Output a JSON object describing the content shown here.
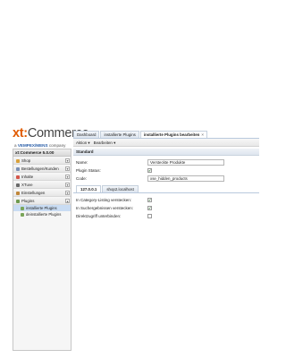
{
  "logo": {
    "brand_xt": "xt",
    "brand_colon": ":",
    "brand_name": "Commerce",
    "sub_prefix": "a",
    "sub_brand": "VEMPEX/MENS",
    "sub_suffix": "company"
  },
  "sidebar": {
    "title": "xt:Commerce 5.0.00",
    "items": [
      {
        "label": "Shop",
        "icon": "shop-icon",
        "color": "#d9a13a"
      },
      {
        "label": "Bestellungen/Kunden",
        "icon": "orders-icon",
        "color": "#7a8fb4"
      },
      {
        "label": "Inhalte",
        "icon": "content-icon",
        "color": "#d4564a"
      },
      {
        "label": "XTuve",
        "icon": "video-icon",
        "color": "#6a6a6a"
      },
      {
        "label": "Einstellungen",
        "icon": "settings-icon",
        "color": "#c0873a"
      },
      {
        "label": "Plugins",
        "icon": "plugin-icon",
        "color": "#6e9b4f"
      }
    ],
    "subitems": [
      {
        "label": "installierte Plugins",
        "selected": true
      },
      {
        "label": "deinstallierte Plugins",
        "selected": false
      }
    ]
  },
  "tabs": [
    {
      "label": "Dashboard",
      "active": false
    },
    {
      "label": "installierte Plugins",
      "active": false
    },
    {
      "label": "installierte Plugins bearbeiten",
      "active": true,
      "close": "×"
    }
  ],
  "toolbar": {
    "aktion": "Aktion ▾",
    "bearbeiten": "Bearbeiten ▾"
  },
  "section": {
    "title": "Standard"
  },
  "form": {
    "name_label": "Name:",
    "name_value": "Versteckte Produkte",
    "status_label": "Plugin Status:",
    "status_checked": "✔",
    "code_label": "Code:",
    "code_value": "xse_hidden_products"
  },
  "subtabs": [
    {
      "label": "127.0.0.1",
      "active": true
    },
    {
      "label": "shop2.localhost",
      "active": false
    }
  ],
  "options": {
    "opt1_label": "In Category-Listing verstecken:",
    "opt1_checked": "✔",
    "opt2_label": "In Suchergebnissen verstecken:",
    "opt2_checked": "✔",
    "opt3_label": "Direktzugriff unterbinden:",
    "opt3_checked": ""
  }
}
